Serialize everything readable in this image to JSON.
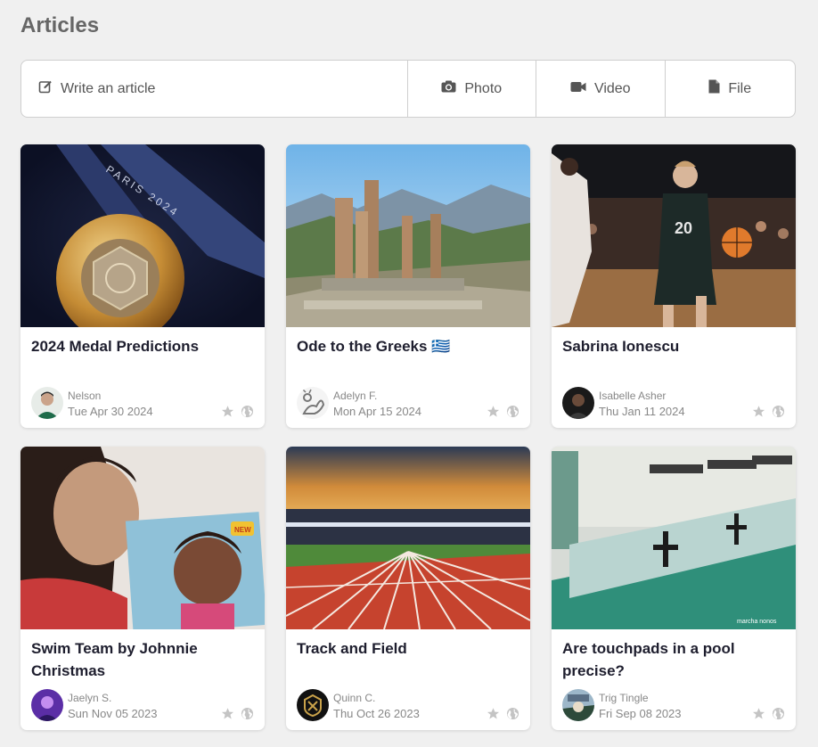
{
  "header": {
    "title": "Articles"
  },
  "composer": {
    "write_label": "Write an article",
    "photo_label": "Photo",
    "video_label": "Video",
    "file_label": "File"
  },
  "articles": [
    {
      "title": "2024 Medal Predictions",
      "author": "Nelson",
      "date": "Tue Apr 30 2024"
    },
    {
      "title": "Ode to the Greeks 🇬🇷",
      "author": "Adelyn F.",
      "date": "Mon Apr 15 2024"
    },
    {
      "title": "Sabrina Ionescu",
      "author": "Isabelle Asher",
      "date": "Thu Jan 11 2024"
    },
    {
      "title": "Swim Team by Johnnie Christmas",
      "author": "Jaelyn S.",
      "date": "Sun Nov 05 2023"
    },
    {
      "title": "Track and Field",
      "author": "Quinn C.",
      "date": "Thu Oct 26 2023"
    },
    {
      "title": "Are touchpads in a pool precise?",
      "author": "Trig Tingle",
      "date": "Fri Sep 08 2023"
    }
  ],
  "image_texts": {
    "medal_ribbon": "PARIS 2024",
    "book_badge": "NEW",
    "pool_watermark": "marcha nonos"
  }
}
